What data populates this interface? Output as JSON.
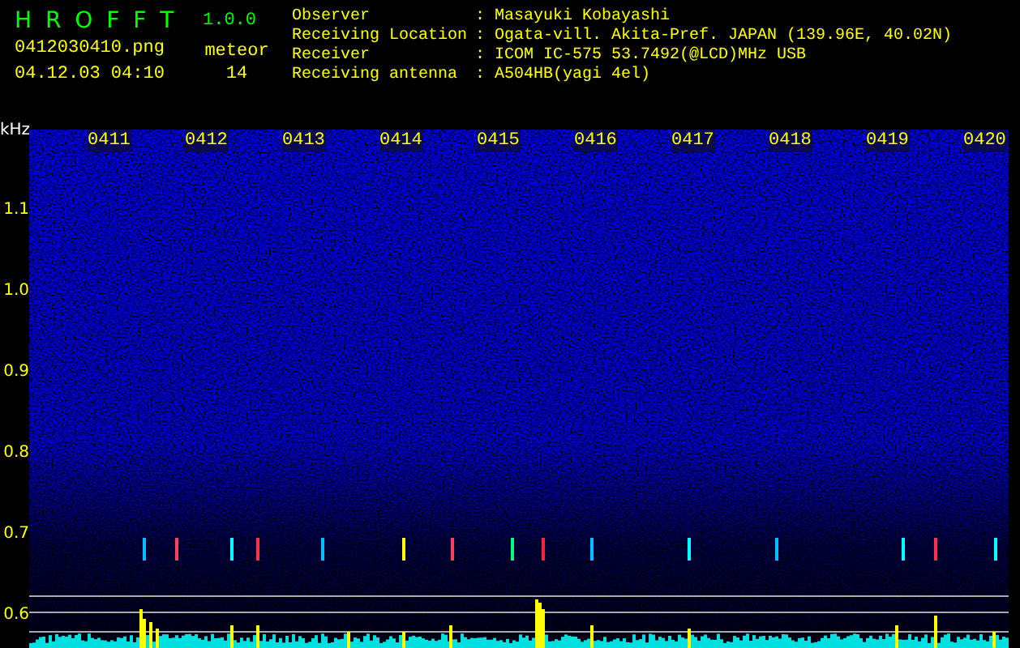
{
  "header": {
    "title": "H R O F F T",
    "version": "1.0.0",
    "filename": "0412030410.png",
    "datetime": "04.12.03 04:10",
    "meteor_label": "meteor",
    "meteor_count": "14"
  },
  "info": [
    {
      "label": "Observer",
      "separator": ":",
      "value": "Masayuki Kobayashi"
    },
    {
      "label": "Receiving Location",
      "separator": ":",
      "value": "Ogata-vill. Akita-Pref. JAPAN (139.96E, 40.02N)"
    },
    {
      "label": "Receiver",
      "separator": ":",
      "value": "ICOM IC-575 53.7492(@LCD)MHz USB"
    },
    {
      "label": "Receiving antenna",
      "separator": ":",
      "value": "A504HB(yagi 4el)"
    }
  ],
  "spectrogram": {
    "unit": "kHz",
    "y_labels": [
      "1.1",
      "1.0",
      "0.9",
      "0.8",
      "0.7",
      "0.6"
    ],
    "time_labels": [
      "0411",
      "0412",
      "0413",
      "0414",
      "0415",
      "0416",
      "0417",
      "0418",
      "0419",
      "0420"
    ]
  }
}
